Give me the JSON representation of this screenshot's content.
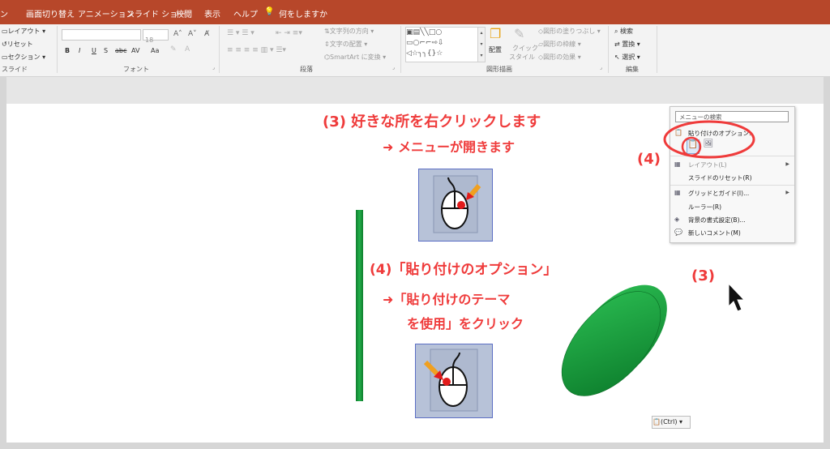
{
  "tabs": [
    "ン",
    "画面切り替え",
    "アニメーション",
    "スライド ショー",
    "校閲",
    "表示",
    "ヘルプ",
    "何をしますか"
  ],
  "ribbon": {
    "slides": {
      "layout": "レイアウト",
      "reset": "リセット",
      "section": "セクション",
      "group": "スライド"
    },
    "font": {
      "size": "18",
      "bold": "B",
      "italic": "I",
      "underline": "U",
      "strike": "S",
      "abc": "abc",
      "spacing": "AV",
      "case": "Aa",
      "group": "フォント"
    },
    "paragraph": {
      "text_direction": "文字列の方向",
      "align_text": "文字の配置",
      "smartart": "SmartArt に変換",
      "group": "段落"
    },
    "drawing": {
      "arrange": "配置",
      "quick_styles": "クイック",
      "quick_styles2": "スタイル",
      "fill": "図形の塗りつぶし",
      "outline": "図形の枠線",
      "effects": "図形の効果",
      "group": "図形描画"
    },
    "editing": {
      "find": "検索",
      "replace": "置換",
      "select": "選択",
      "group": "編集"
    }
  },
  "slide": {
    "step3_title": "(3) 好きな所を右クリックします",
    "step3_sub": "➜ メニューが開きます",
    "step4_title": "(4)「貼り付けのオプション」",
    "step4_sub1": "➜「貼り付けのテーマ",
    "step4_sub2": "を使用」をクリック",
    "label4": "(4)",
    "label3": "(3)",
    "ctrl_badge": "(Ctrl)"
  },
  "menu": {
    "search_placeholder": "メニューの検索",
    "paste_options": "貼り付けのオプション:",
    "layout": "レイアウト(L)",
    "reset_slide": "スライドのリセット(R)",
    "grid": "グリッドとガイド(I)...",
    "ruler": "ルーラー(R)",
    "background": "背景の書式設定(B)...",
    "new_comment": "新しいコメント(M)"
  },
  "colors": {
    "accent": "#b7472a",
    "annotation": "#ef3b3b",
    "green": "#139a3a"
  }
}
